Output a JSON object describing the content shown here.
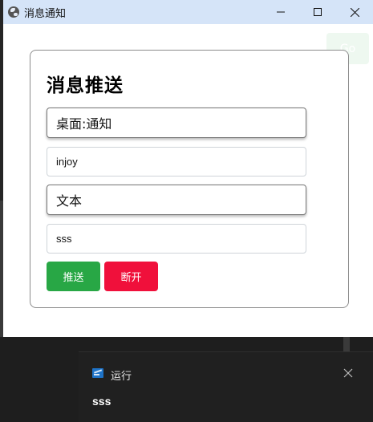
{
  "window": {
    "title": "消息通知",
    "controls": {
      "minimize": "minimize-icon",
      "maximize": "maximize-icon",
      "close": "close-icon"
    }
  },
  "ghost_button": {
    "label": "Go"
  },
  "form": {
    "heading": "消息推送",
    "channel_select": {
      "value": "桌面:通知"
    },
    "title_input": {
      "value": "injoy"
    },
    "type_select": {
      "value": "文本"
    },
    "content_input": {
      "value": "sss"
    },
    "buttons": {
      "push": "推送",
      "disconnect": "断开"
    },
    "colors": {
      "push": "#28a745",
      "disconnect": "#f0103b"
    }
  },
  "toast": {
    "app_name": "运行",
    "message": "sss",
    "icon": "run-app-icon",
    "close_icon": "close-icon"
  }
}
